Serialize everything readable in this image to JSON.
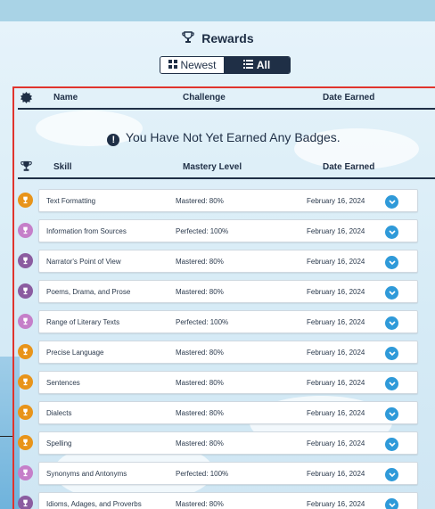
{
  "title": "Rewards",
  "toggle": {
    "newest_label": "Newest",
    "all_label": "All",
    "active": "All"
  },
  "badges_table": {
    "headers": {
      "name": "Name",
      "challenge": "Challenge",
      "date": "Date Earned"
    },
    "empty_message": "You Have Not Yet Earned Any Badges."
  },
  "skills_table": {
    "headers": {
      "skill": "Skill",
      "mastery": "Mastery Level",
      "date": "Date Earned"
    },
    "rows": [
      {
        "skill": "Text Formatting",
        "mastery": "Mastered: 80%",
        "date": "February 16, 2024",
        "medal": "gold"
      },
      {
        "skill": "Information from Sources",
        "mastery": "Perfected: 100%",
        "date": "February 16, 2024",
        "medal": "pink"
      },
      {
        "skill": "Narrator's Point of View",
        "mastery": "Mastered: 80%",
        "date": "February 16, 2024",
        "medal": "purple"
      },
      {
        "skill": "Poems, Drama, and Prose",
        "mastery": "Mastered: 80%",
        "date": "February 16, 2024",
        "medal": "purple"
      },
      {
        "skill": "Range of Literary Texts",
        "mastery": "Perfected: 100%",
        "date": "February 16, 2024",
        "medal": "pink"
      },
      {
        "skill": "Precise Language",
        "mastery": "Mastered: 80%",
        "date": "February 16, 2024",
        "medal": "gold"
      },
      {
        "skill": "Sentences",
        "mastery": "Mastered: 80%",
        "date": "February 16, 2024",
        "medal": "gold"
      },
      {
        "skill": "Dialects",
        "mastery": "Mastered: 80%",
        "date": "February 16, 2024",
        "medal": "gold"
      },
      {
        "skill": "Spelling",
        "mastery": "Mastered: 80%",
        "date": "February 16, 2024",
        "medal": "gold"
      },
      {
        "skill": "Synonyms and Antonyms",
        "mastery": "Perfected: 100%",
        "date": "February 16, 2024",
        "medal": "pink"
      },
      {
        "skill": "Idioms, Adages, and Proverbs",
        "mastery": "Mastered: 80%",
        "date": "February 16, 2024",
        "medal": "purple"
      }
    ]
  },
  "colors": {
    "navy": "#1f2f46",
    "accent_blue": "#2f9ad9",
    "panel_border": "#e0342d",
    "medal_gold": "#e8941a",
    "medal_pink": "#c57fc9",
    "medal_purple": "#8b5ca0"
  },
  "icons": {
    "title": "trophy-icon",
    "newest": "grid-icon",
    "all": "list-icon",
    "badge_col": "badge-icon",
    "skill_col": "trophy-icon",
    "empty": "info-icon",
    "row_action": "chevron-down-icon"
  }
}
